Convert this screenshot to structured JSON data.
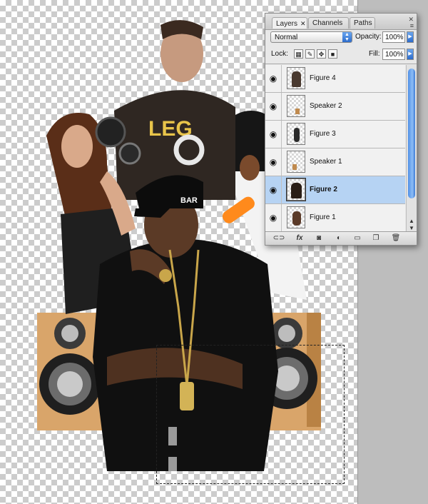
{
  "canvas": {
    "description_icon": "transparency-checkerboard"
  },
  "layers_panel": {
    "tabs": [
      {
        "label": "Layers",
        "active": true
      },
      {
        "label": "Channels",
        "active": false
      },
      {
        "label": "Paths",
        "active": false
      }
    ],
    "blend_mode": "Normal",
    "opacity_label": "Opacity:",
    "opacity_value": "100%",
    "lock_label": "Lock:",
    "fill_label": "Fill:",
    "fill_value": "100%",
    "layers": [
      {
        "name": "Figure 4",
        "visible": true,
        "selected": false
      },
      {
        "name": "Speaker 2",
        "visible": true,
        "selected": false
      },
      {
        "name": "Figure 3",
        "visible": true,
        "selected": false
      },
      {
        "name": "Speaker 1",
        "visible": true,
        "selected": false
      },
      {
        "name": "Figure 2",
        "visible": true,
        "selected": true
      },
      {
        "name": "Figure 1",
        "visible": true,
        "selected": false
      }
    ],
    "bottom_icons": [
      "link-icon",
      "fx-icon",
      "mask-icon",
      "adjustment-icon",
      "folder-icon",
      "new-layer-icon",
      "trash-icon"
    ]
  },
  "artwork": {
    "cap_text": "BAR",
    "shirt_text": "LEG"
  },
  "colors": {
    "selection_highlight": "#b6d3f3",
    "scrollbar_blue": "#4f8fe6"
  }
}
